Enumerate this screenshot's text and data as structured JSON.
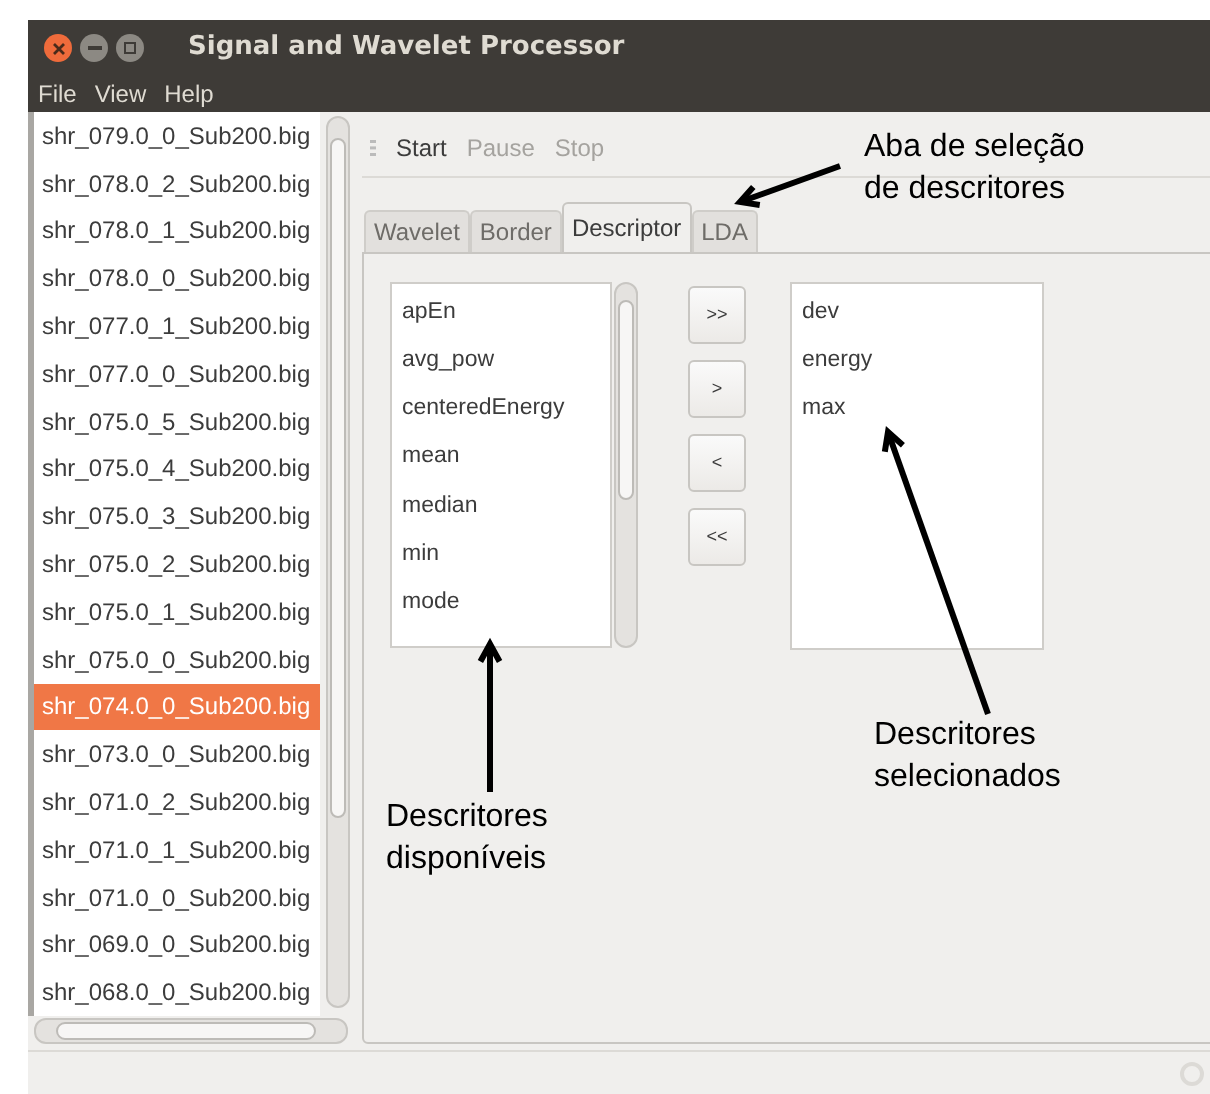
{
  "window": {
    "title": "Signal and Wavelet Processor"
  },
  "menu": [
    "File",
    "View",
    "Help"
  ],
  "files": [
    {
      "name": "shr_079.0_0_Sub200.big",
      "selected": false
    },
    {
      "name": "shr_078.0_2_Sub200.big",
      "selected": false
    },
    {
      "name": "shr_078.0_1_Sub200.big",
      "selected": false
    },
    {
      "name": "shr_078.0_0_Sub200.big",
      "selected": false
    },
    {
      "name": "shr_077.0_1_Sub200.big",
      "selected": false
    },
    {
      "name": "shr_077.0_0_Sub200.big",
      "selected": false
    },
    {
      "name": "shr_075.0_5_Sub200.big",
      "selected": false
    },
    {
      "name": "shr_075.0_4_Sub200.big",
      "selected": false
    },
    {
      "name": "shr_075.0_3_Sub200.big",
      "selected": false
    },
    {
      "name": "shr_075.0_2_Sub200.big",
      "selected": false
    },
    {
      "name": "shr_075.0_1_Sub200.big",
      "selected": false
    },
    {
      "name": "shr_075.0_0_Sub200.big",
      "selected": false
    },
    {
      "name": "shr_074.0_0_Sub200.big",
      "selected": true
    },
    {
      "name": "shr_073.0_0_Sub200.big",
      "selected": false
    },
    {
      "name": "shr_071.0_2_Sub200.big",
      "selected": false
    },
    {
      "name": "shr_071.0_1_Sub200.big",
      "selected": false
    },
    {
      "name": "shr_071.0_0_Sub200.big",
      "selected": false
    },
    {
      "name": "shr_069.0_0_Sub200.big",
      "selected": false
    },
    {
      "name": "shr_068.0_0_Sub200.big",
      "selected": false
    }
  ],
  "toolbar": [
    {
      "label": "Start",
      "disabled": false
    },
    {
      "label": "Pause",
      "disabled": true
    },
    {
      "label": "Stop",
      "disabled": true
    }
  ],
  "tabs": [
    {
      "label": "Wavelet",
      "selected": false
    },
    {
      "label": "Border",
      "selected": false
    },
    {
      "label": "Descriptor",
      "selected": true
    },
    {
      "label": "LDA",
      "selected": false
    }
  ],
  "available": [
    "apEn",
    "avg_pow",
    "centeredEnergy",
    "mean",
    "median",
    "min",
    "mode"
  ],
  "move_buttons": [
    ">>",
    ">",
    "<",
    "<<"
  ],
  "selected_descriptors": [
    "dev",
    "energy",
    "max"
  ],
  "annotations": [
    {
      "lines": [
        "Aba de seleção",
        "de descritores"
      ]
    },
    {
      "lines": [
        "Descritores",
        "disponíveis"
      ]
    },
    {
      "lines": [
        "Descritores",
        "selecionados"
      ]
    }
  ]
}
